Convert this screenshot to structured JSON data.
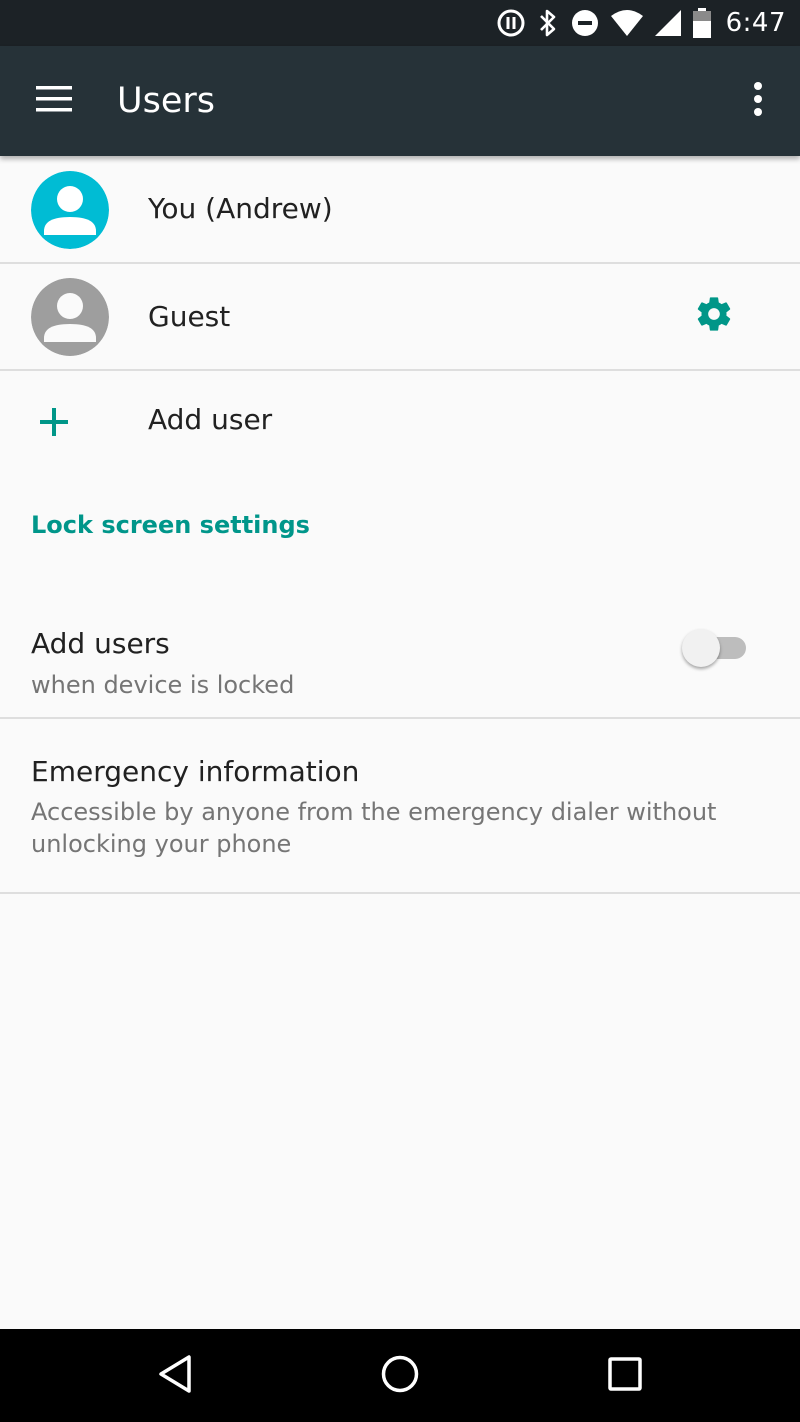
{
  "status_bar": {
    "time": "6:47",
    "icons": [
      "pause-circle-icon",
      "bluetooth-icon",
      "do-not-disturb-icon",
      "wifi-icon",
      "cellular-signal-icon",
      "battery-icon"
    ]
  },
  "app_bar": {
    "title": "Users",
    "menu_icon": "hamburger-menu-icon",
    "overflow_icon": "more-vert-icon"
  },
  "users": [
    {
      "label": "You (Andrew)",
      "avatar_color": "#00bcd4",
      "active": true
    },
    {
      "label": "Guest",
      "avatar_color": "#9e9e9e",
      "has_settings": true
    }
  ],
  "add_user": {
    "label": "Add user"
  },
  "lock_screen": {
    "header": "Lock screen settings",
    "add_users_title": "Add users",
    "add_users_summary": "when device is locked",
    "add_users_enabled": false
  },
  "emergency": {
    "title": "Emergency information",
    "summary": "Accessible by anyone from the emergency dialer without unlocking your phone"
  },
  "colors": {
    "accent": "#009688",
    "app_bar": "#263238",
    "status_bar": "#1c2226",
    "background": "#fafafa"
  },
  "nav_bar": {
    "buttons": [
      "back-icon",
      "home-icon",
      "recents-icon"
    ]
  }
}
